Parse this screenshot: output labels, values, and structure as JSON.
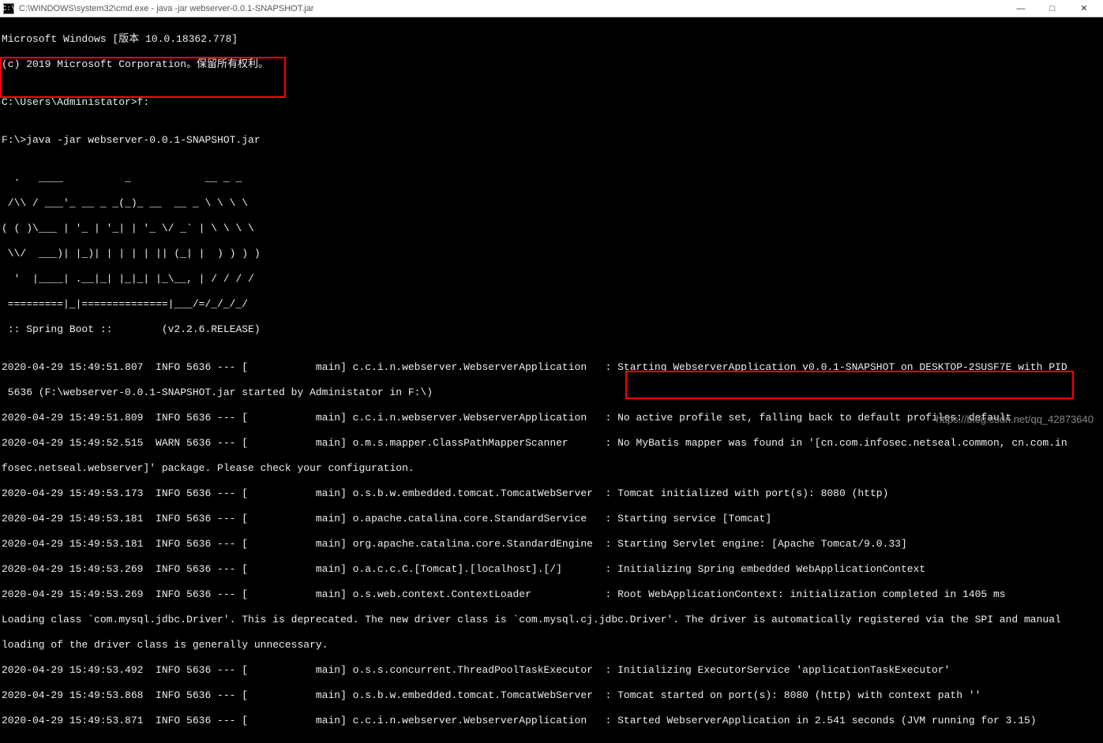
{
  "titlebar": {
    "icon_label": "cmd",
    "title": "C:\\WINDOWS\\system32\\cmd.exe - java  -jar webserver-0.0.1-SNAPSHOT.jar"
  },
  "window_controls": {
    "minimize": "—",
    "maximize": "□",
    "close": "✕"
  },
  "terminal_lines": {
    "l0": "Microsoft Windows [版本 10.0.18362.778]",
    "l1": "(c) 2019 Microsoft Corporation。保留所有权利。",
    "l2": "",
    "l3": "C:\\Users\\Administator>f:",
    "l4": "",
    "l5": "F:\\>java -jar webserver-0.0.1-SNAPSHOT.jar",
    "l6": "",
    "l7": "  .   ____          _            __ _ _",
    "l8": " /\\\\ / ___'_ __ _ _(_)_ __  __ _ \\ \\ \\ \\",
    "l9": "( ( )\\___ | '_ | '_| | '_ \\/ _` | \\ \\ \\ \\",
    "l10": " \\\\/  ___)| |_)| | | | | || (_| |  ) ) ) )",
    "l11": "  '  |____| .__|_| |_|_| |_\\__, | / / / /",
    "l12": " =========|_|==============|___/=/_/_/_/",
    "l13": " :: Spring Boot ::        (v2.2.6.RELEASE)",
    "l14": "",
    "l15": "2020-04-29 15:49:51.807  INFO 5636 --- [           main] c.c.i.n.webserver.WebserverApplication   : Starting WebserverApplication v0.0.1-SNAPSHOT on DESKTOP-2SUSF7E with PID",
    "l16": " 5636 (F:\\webserver-0.0.1-SNAPSHOT.jar started by Administator in F:\\)",
    "l17": "2020-04-29 15:49:51.809  INFO 5636 --- [           main] c.c.i.n.webserver.WebserverApplication   : No active profile set, falling back to default profiles: default",
    "l18": "2020-04-29 15:49:52.515  WARN 5636 --- [           main] o.m.s.mapper.ClassPathMapperScanner      : No MyBatis mapper was found in '[cn.com.infosec.netseal.common, cn.com.in",
    "l19": "fosec.netseal.webserver]' package. Please check your configuration.",
    "l20": "2020-04-29 15:49:53.173  INFO 5636 --- [           main] o.s.b.w.embedded.tomcat.TomcatWebServer  : Tomcat initialized with port(s): 8080 (http)",
    "l21": "2020-04-29 15:49:53.181  INFO 5636 --- [           main] o.apache.catalina.core.StandardService   : Starting service [Tomcat]",
    "l22": "2020-04-29 15:49:53.181  INFO 5636 --- [           main] org.apache.catalina.core.StandardEngine  : Starting Servlet engine: [Apache Tomcat/9.0.33]",
    "l23": "2020-04-29 15:49:53.269  INFO 5636 --- [           main] o.a.c.c.C.[Tomcat].[localhost].[/]       : Initializing Spring embedded WebApplicationContext",
    "l24": "2020-04-29 15:49:53.269  INFO 5636 --- [           main] o.s.web.context.ContextLoader            : Root WebApplicationContext: initialization completed in 1405 ms",
    "l25": "Loading class `com.mysql.jdbc.Driver'. This is deprecated. The new driver class is `com.mysql.cj.jdbc.Driver'. The driver is automatically registered via the SPI and manual",
    "l26": "loading of the driver class is generally unnecessary.",
    "l27": "2020-04-29 15:49:53.492  INFO 5636 --- [           main] o.s.s.concurrent.ThreadPoolTaskExecutor  : Initializing ExecutorService 'applicationTaskExecutor'",
    "l28": "2020-04-29 15:49:53.868  INFO 5636 --- [           main] o.s.b.w.embedded.tomcat.TomcatWebServer  : Tomcat started on port(s): 8080 (http) with context path ''",
    "l29": "2020-04-29 15:49:53.871  INFO 5636 --- [           main] c.c.i.n.webserver.WebserverApplication   : Started WebserverApplication in 2.541 seconds (JVM running for 3.15)"
  },
  "watermark": "https://blog.csdn.net/qq_42873640"
}
